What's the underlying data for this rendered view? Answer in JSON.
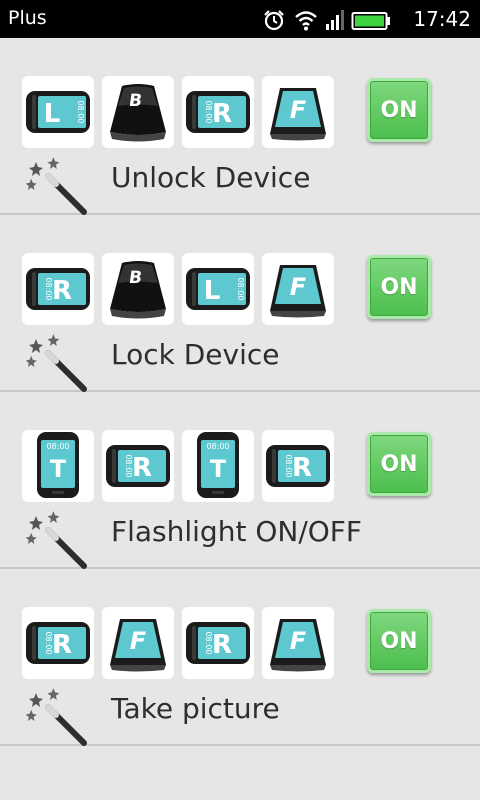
{
  "status_bar": {
    "carrier": "Plus",
    "time": "17:42",
    "icons": [
      "alarm-icon",
      "wifi-icon",
      "signal-icon",
      "battery-icon"
    ]
  },
  "actions": [
    {
      "label": "Unlock Device",
      "toggle": "ON",
      "gestures": [
        {
          "type": "landscape",
          "letter": "L",
          "clock": "08:00"
        },
        {
          "type": "back",
          "letter": "B"
        },
        {
          "type": "landscape",
          "letter": "R",
          "clock": "08:00"
        },
        {
          "type": "front",
          "letter": "F"
        }
      ]
    },
    {
      "label": "Lock Device",
      "toggle": "ON",
      "gestures": [
        {
          "type": "landscape",
          "letter": "R",
          "clock": "08:00"
        },
        {
          "type": "back",
          "letter": "B"
        },
        {
          "type": "landscape",
          "letter": "L",
          "clock": "08:00"
        },
        {
          "type": "front",
          "letter": "F"
        }
      ]
    },
    {
      "label": "Flashlight ON/OFF",
      "toggle": "ON",
      "gestures": [
        {
          "type": "portrait",
          "letter": "T",
          "clock": "08:00"
        },
        {
          "type": "landscape",
          "letter": "R",
          "clock": "08:00"
        },
        {
          "type": "portrait",
          "letter": "T",
          "clock": "08:00"
        },
        {
          "type": "landscape",
          "letter": "R",
          "clock": "08:00"
        }
      ]
    },
    {
      "label": "Take picture",
      "toggle": "ON",
      "gestures": [
        {
          "type": "landscape",
          "letter": "R",
          "clock": "08:00"
        },
        {
          "type": "front",
          "letter": "F"
        },
        {
          "type": "landscape",
          "letter": "R",
          "clock": "08:00"
        },
        {
          "type": "front",
          "letter": "F"
        }
      ]
    }
  ],
  "colors": {
    "screen": "#5ec8d0",
    "toggle_on": "#5cc95c",
    "label": "#2e2e2e"
  }
}
